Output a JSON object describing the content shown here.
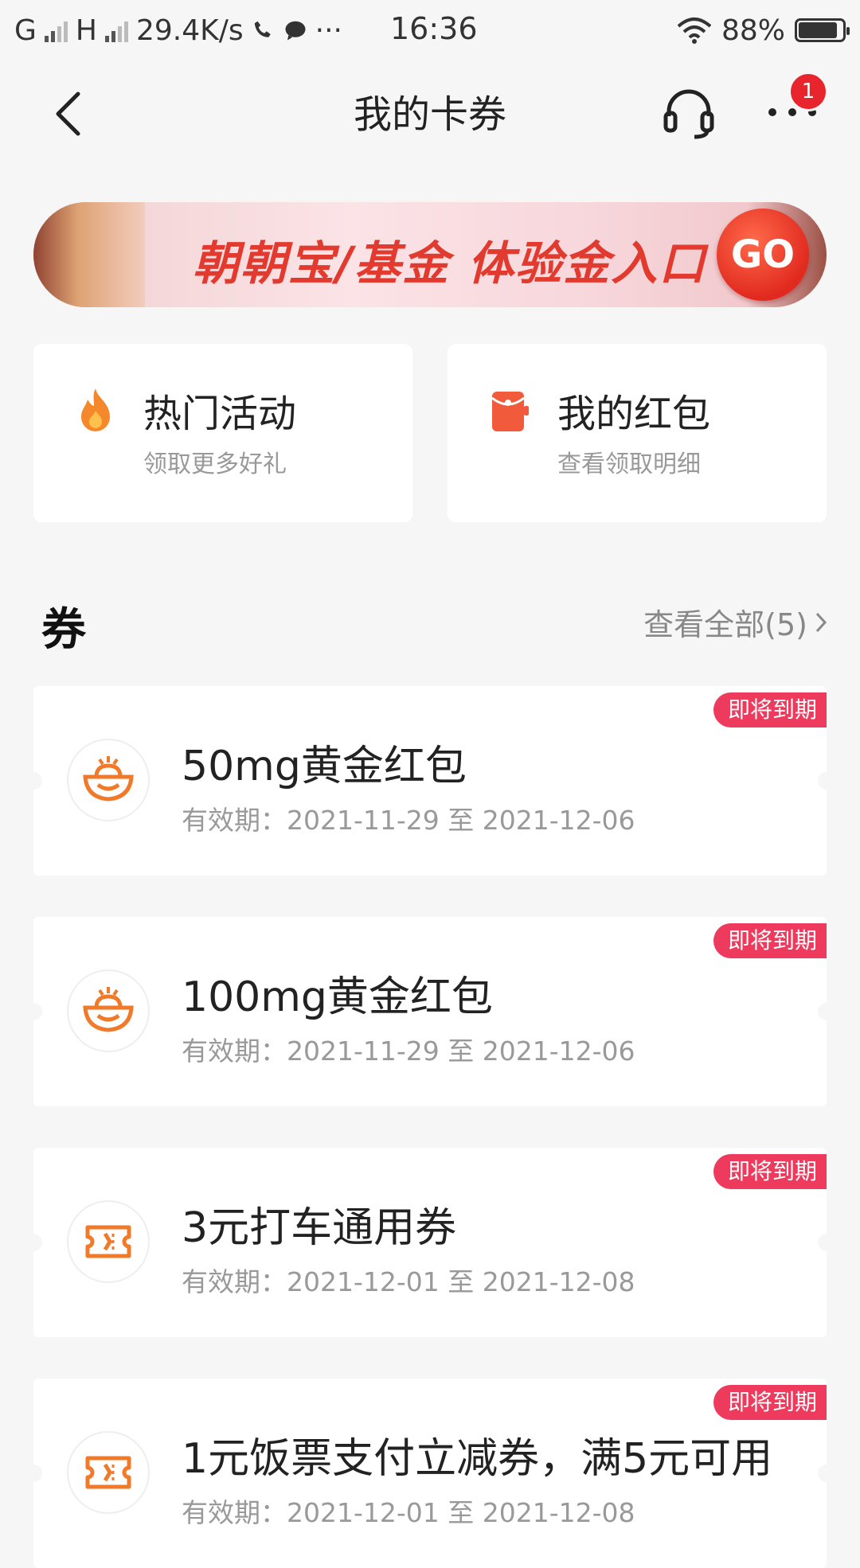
{
  "status_bar": {
    "net1": "G",
    "net2": "H",
    "speed": "29.4K/s",
    "dots": "···",
    "time": "16:36",
    "battery": "88%"
  },
  "nav": {
    "title": "我的卡券",
    "badge_count": "1"
  },
  "banner": {
    "text": "朝朝宝/基金 体验金入口",
    "go_label": "GO"
  },
  "quick": [
    {
      "title": "热门活动",
      "subtitle": "领取更多好礼",
      "icon": "flame-icon"
    },
    {
      "title": "我的红包",
      "subtitle": "查看领取明细",
      "icon": "red-envelope-icon"
    }
  ],
  "section": {
    "title": "券",
    "view_all": "查看全部(5)"
  },
  "coupons": [
    {
      "name": "50mg黄金红包",
      "validity": "有效期：2021-11-29 至 2021-12-06",
      "tag": "即将到期",
      "icon": "gold-ingot-icon"
    },
    {
      "name": "100mg黄金红包",
      "validity": "有效期：2021-11-29 至 2021-12-06",
      "tag": "即将到期",
      "icon": "gold-ingot-icon"
    },
    {
      "name": "3元打车通用券",
      "validity": "有效期：2021-12-01 至 2021-12-08",
      "tag": "即将到期",
      "icon": "ticket-icon"
    },
    {
      "name": "1元饭票支付立减券，满5元可用",
      "validity": "有效期：2021-12-01 至 2021-12-08",
      "tag": "即将到期",
      "icon": "ticket-icon"
    }
  ],
  "colors": {
    "accent": "#e8242c",
    "tag": "#ee3a5c",
    "icon_orange": "#f07a2a"
  }
}
